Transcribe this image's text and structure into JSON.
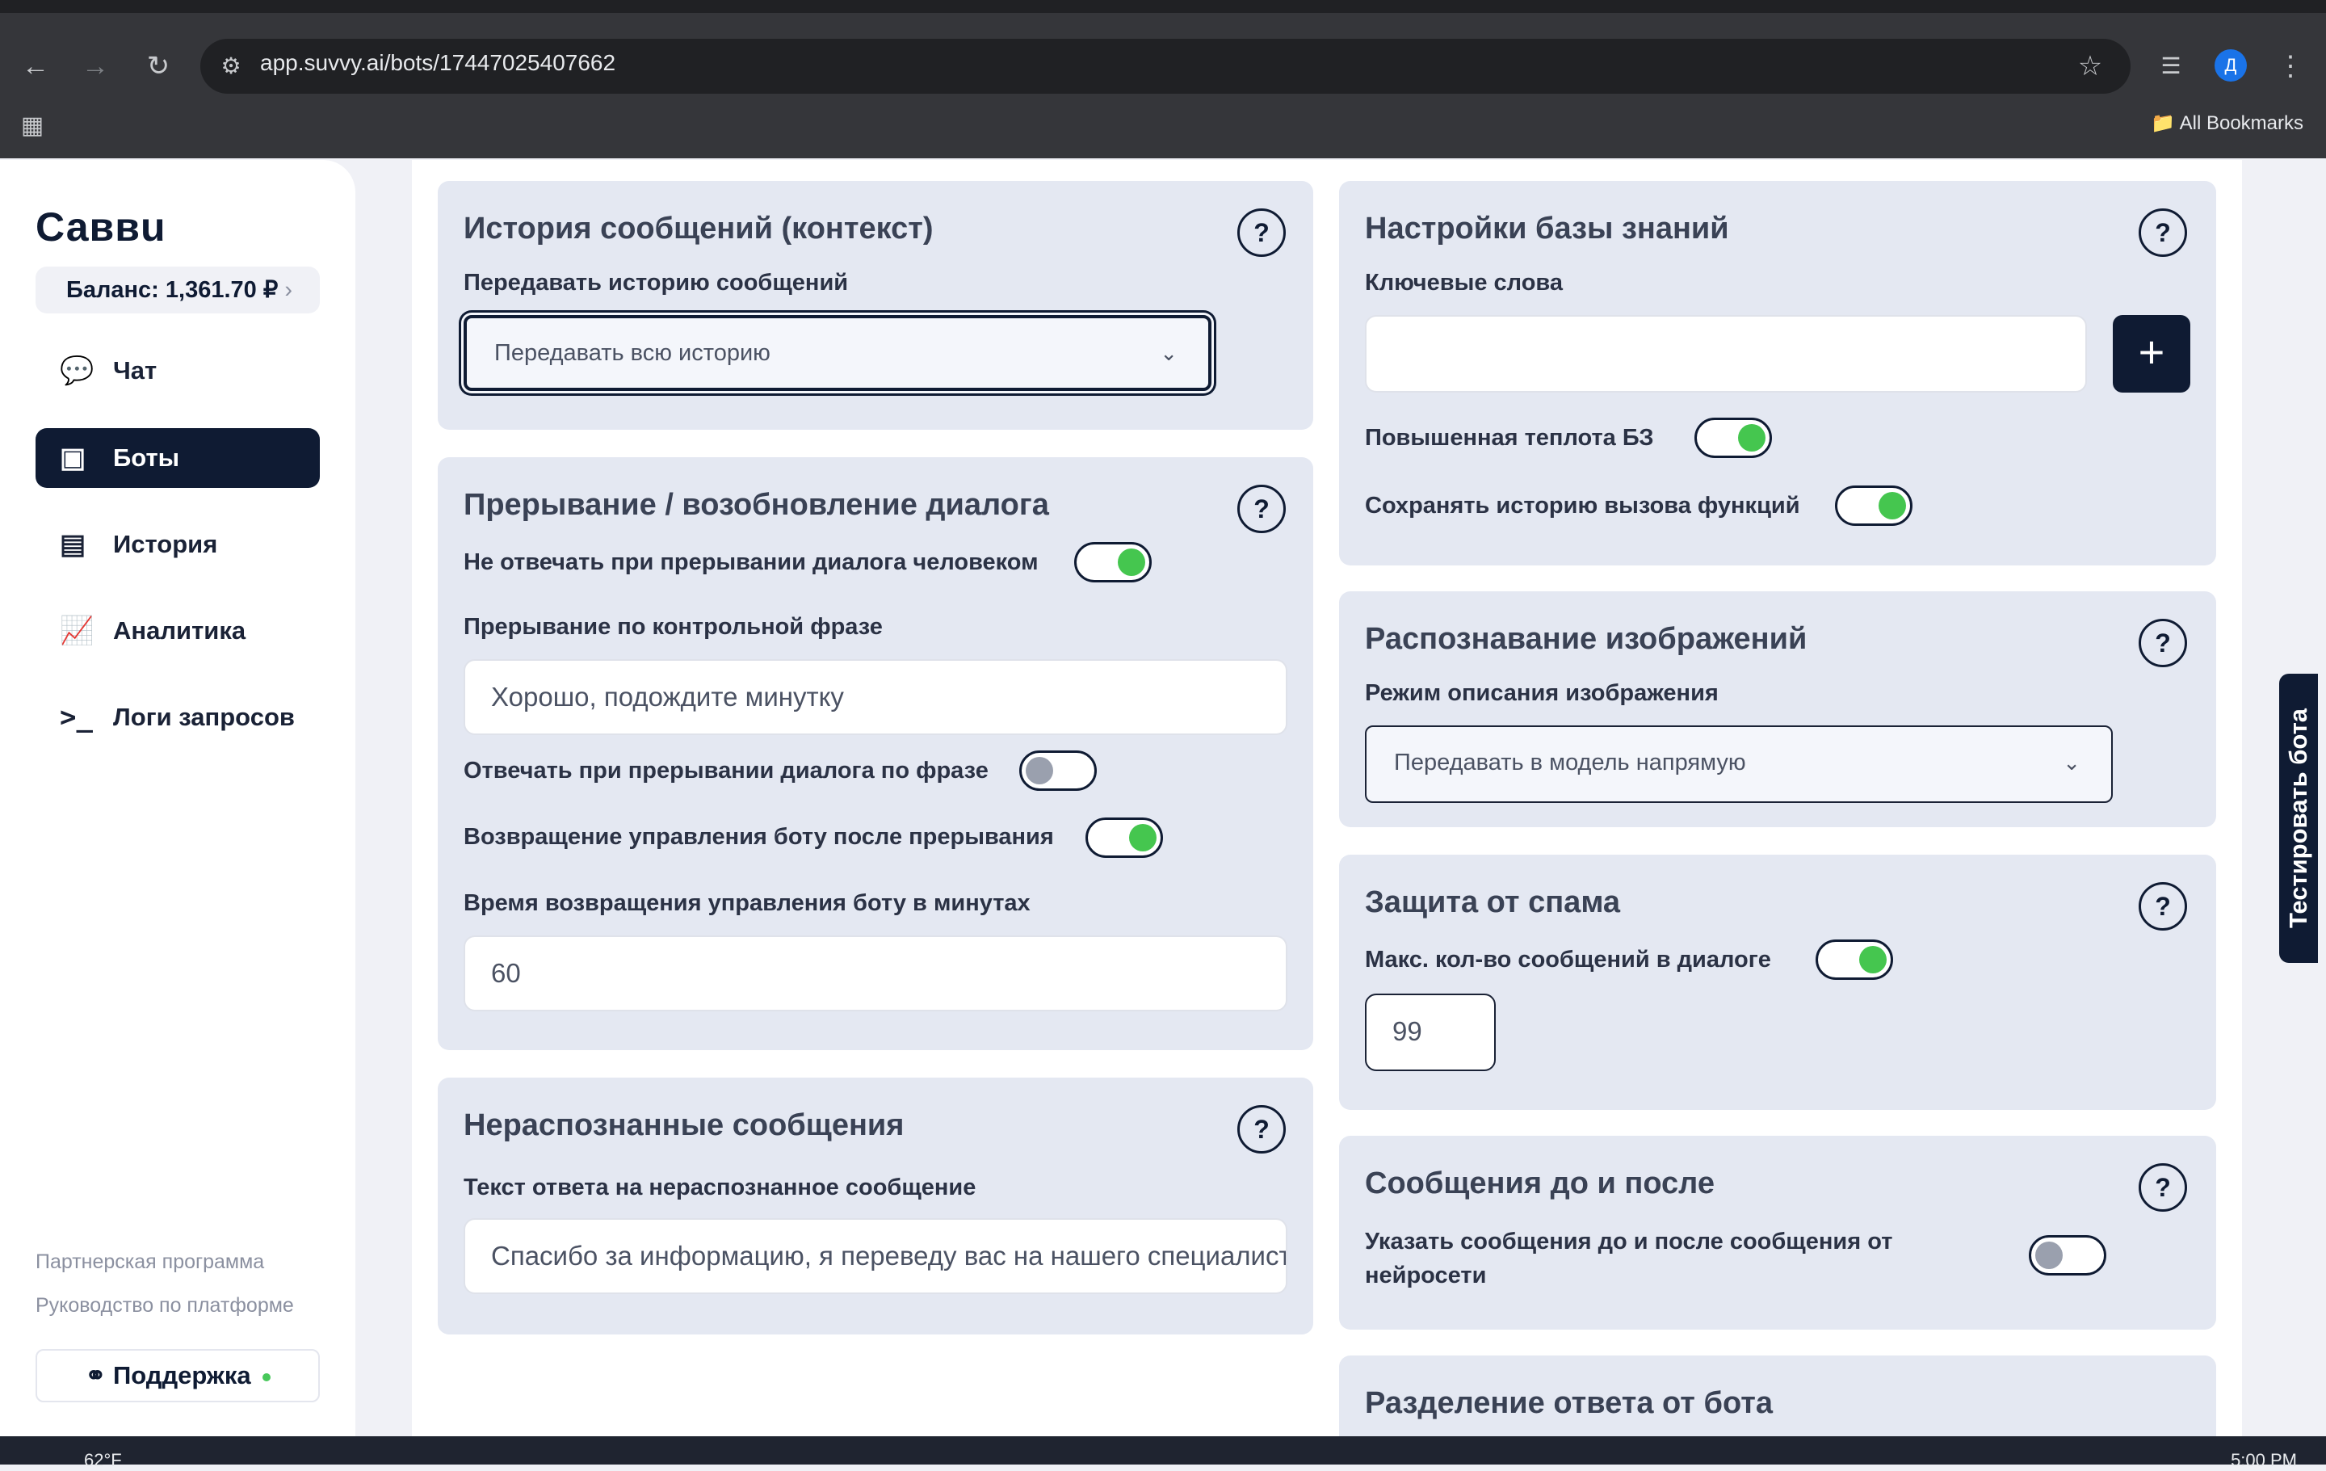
{
  "browser": {
    "url": "app.suvvy.ai/bots/17447025407662",
    "bookmarks_label": "All Bookmarks",
    "profile_letter": "Д"
  },
  "sidebar": {
    "logo": "Саввu",
    "balance": "Баланс: 1,361.70 ₽",
    "nav": [
      {
        "label": "Чат",
        "icon": "chat-icon"
      },
      {
        "label": "Боты",
        "icon": "bot-icon"
      },
      {
        "label": "История",
        "icon": "history-icon"
      },
      {
        "label": "Аналитика",
        "icon": "analytics-icon"
      },
      {
        "label": "Логи запросов",
        "icon": "terminal-icon"
      }
    ],
    "partner_link": "Партнерская программа",
    "guide_link": "Руководство по платформе",
    "support": "Поддержка"
  },
  "cards": {
    "history": {
      "title": "История сообщений (контекст)",
      "label": "Передавать историю сообщений",
      "select_value": "Передавать всю историю"
    },
    "interrupt": {
      "title": "Прерывание / возобновление диалога",
      "no_reply_label": "Не отвечать при прерывании диалога человеком",
      "phrase_label": "Прерывание по контрольной фразе",
      "phrase_value": "Хорошо, подождите минутку",
      "reply_on_phrase_label": "Отвечать при прерывании диалога по фразе",
      "return_label": "Возвращение управления боту после прерывания",
      "minutes_label": "Время возвращения управления боту в минутах",
      "minutes_value": "60"
    },
    "unrecognized": {
      "title": "Нераспознанные сообщения",
      "label": "Текст ответа на нераспознанное сообщение",
      "value": "Спасибо за информацию, я переведу вас на нашего специалиста"
    },
    "kb": {
      "title": "Настройки базы знаний",
      "keywords_label": "Ключевые слова",
      "keywords_value": "",
      "temp_label": "Повышенная теплота БЗ",
      "save_label": "Сохранять историю вызова функций"
    },
    "images": {
      "title": "Распознавание изображений",
      "label": "Режим описания изображения",
      "select_value": "Передавать в модель напрямую"
    },
    "spam": {
      "title": "Защита от спама",
      "label": "Макс. кол-во сообщений в диалоге",
      "value": "99"
    },
    "before_after": {
      "title": "Сообщения до и после",
      "label": "Указать сообщения до и после сообщения от нейросети"
    },
    "split": {
      "title": "Разделение ответа от бота"
    }
  },
  "test_tab": "Тестировать бота",
  "taskbar": {
    "weather": "62°F",
    "clock": "5:00 PM"
  },
  "colors": {
    "accent": "#0f1b33",
    "toggle_on": "#45c64f",
    "card_bg": "#e4e8f2"
  }
}
